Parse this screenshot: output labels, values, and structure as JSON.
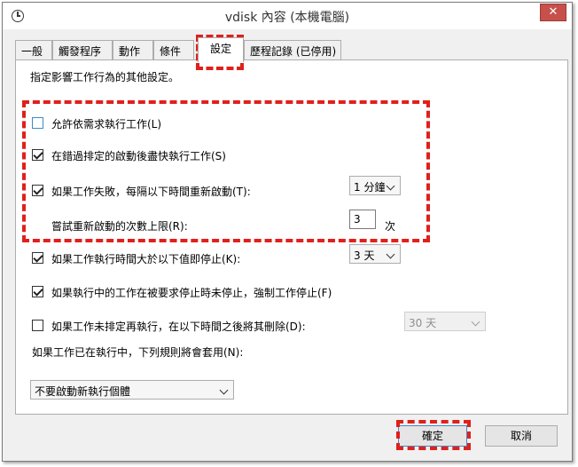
{
  "window": {
    "title": "vdisk 內容 (本機電腦)",
    "close_glyph": "✕",
    "accent_color": "#c7504b",
    "highlight_color": "#e0201b"
  },
  "tabs": [
    {
      "label": "一般"
    },
    {
      "label": "觸發程序"
    },
    {
      "label": "動作"
    },
    {
      "label": "條件"
    },
    {
      "label": "設定"
    },
    {
      "label": "歷程記錄 (已停用)"
    }
  ],
  "settings": {
    "description": "指定影響工作行為的其他設定。",
    "allow_on_demand": {
      "label": "允許依需求執行工作(L)",
      "checked": false
    },
    "run_asap": {
      "label": "在錯過排定的啟動後盡快執行工作(S)",
      "checked": true
    },
    "restart_on_fail": {
      "label": "如果工作失敗，每隔以下時間重新啟動(T):",
      "checked": true,
      "interval": "1 分鐘"
    },
    "restart_attempts": {
      "label": "嘗試重新啟動的次數上限(R):",
      "value": "3",
      "unit": "次"
    },
    "stop_if_runs_longer": {
      "label": "如果工作執行時間大於以下值即停止(K):",
      "checked": true,
      "duration": "3 天"
    },
    "force_stop": {
      "label": "如果執行中的工作在被要求停止時未停止，強制工作停止(F)",
      "checked": true
    },
    "delete_if_not_scheduled": {
      "label": "如果工作未排定再執行，在以下時間之後將其刪除(D):",
      "checked": false,
      "duration": "30 天"
    },
    "running_rule_label": "如果工作已在執行中，下列規則將會套用(N):",
    "running_rule_value": "不要啟動新執行個體"
  },
  "buttons": {
    "ok": "確定",
    "cancel": "取消"
  }
}
